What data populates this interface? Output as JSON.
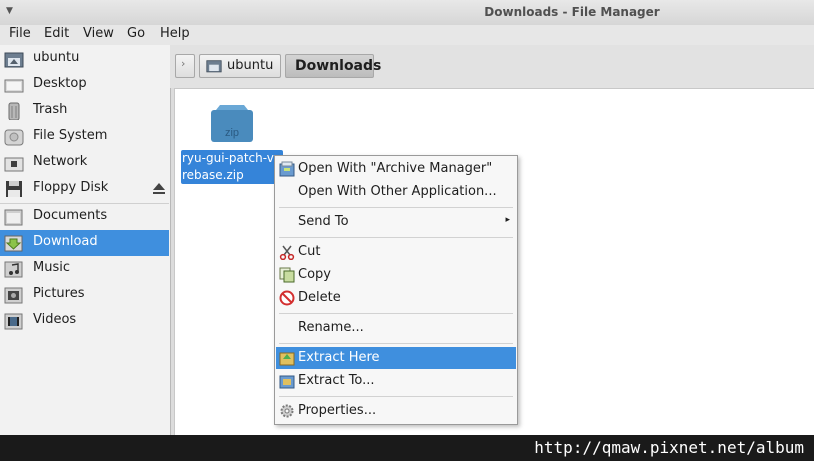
{
  "window": {
    "title": "Downloads - File Manager"
  },
  "menubar": {
    "items": [
      "File",
      "Edit",
      "View",
      "Go",
      "Help"
    ]
  },
  "sidebar": {
    "items": [
      {
        "label": "ubuntu",
        "icon": "home-icon"
      },
      {
        "label": "Desktop",
        "icon": "desktop-icon"
      },
      {
        "label": "Trash",
        "icon": "trash-icon"
      },
      {
        "label": "File System",
        "icon": "drive-icon"
      },
      {
        "label": "Network",
        "icon": "network-icon"
      },
      {
        "label": "Floppy Disk",
        "icon": "floppy-icon"
      },
      {
        "label": "Documents",
        "icon": "folder-icon"
      },
      {
        "label": "Download",
        "icon": "download-folder-icon"
      },
      {
        "label": "Music",
        "icon": "music-folder-icon"
      },
      {
        "label": "Pictures",
        "icon": "pictures-folder-icon"
      },
      {
        "label": "Videos",
        "icon": "videos-folder-icon"
      }
    ],
    "selected": "Download"
  },
  "pathbar": {
    "crumbs": [
      "ubuntu",
      "Downloads"
    ]
  },
  "file": {
    "icon_text": "zip",
    "name_line1": "ryu-gui-patch-v",
    "name_line2": "rebase.zip"
  },
  "context_menu": {
    "open_with_archive": "Open With \"Archive Manager\"",
    "open_with_other": "Open With Other Application...",
    "send_to": "Send To",
    "cut": "Cut",
    "copy": "Copy",
    "delete": "Delete",
    "rename": "Rename...",
    "extract_here": "Extract Here",
    "extract_to": "Extract To...",
    "properties": "Properties..."
  },
  "watermark": "http://qmaw.pixnet.net/album",
  "colors": {
    "selection": "#3f8fde",
    "zip_icon": "#4a8bbd"
  }
}
